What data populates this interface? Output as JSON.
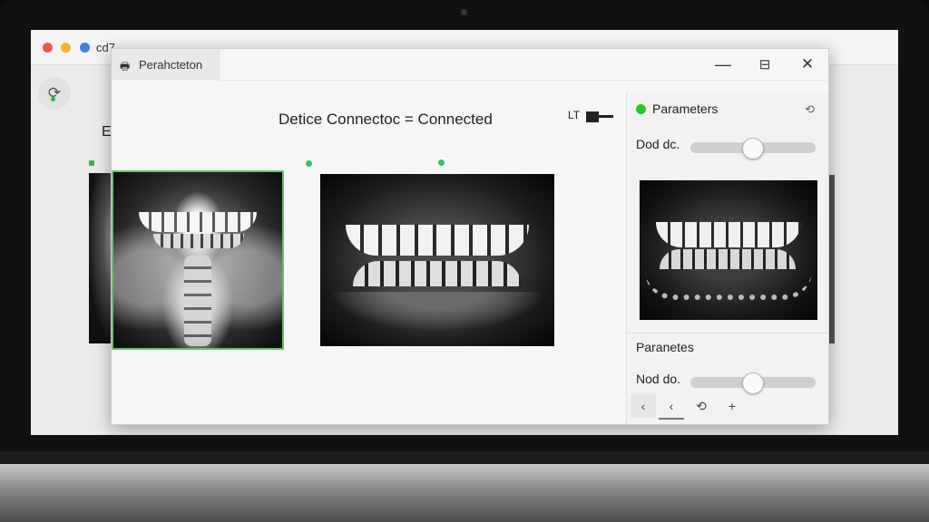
{
  "background_window": {
    "title": "cd7-",
    "partial_letter": "E"
  },
  "window": {
    "tab_label": "Perahcteton",
    "tab_icon": "printer-icon",
    "controls": {
      "minimize": "—",
      "maximize": "⊟",
      "close": "✕"
    }
  },
  "status": {
    "text": "Detice Connectoc = Connected",
    "usb_label": "LT"
  },
  "panel": {
    "title": "Parameters",
    "slider1": {
      "label": "Dod dc.",
      "value": 0.5
    },
    "subtitle": "Paranetes",
    "slider2": {
      "label": "Nod do.",
      "value": 0.5
    },
    "status_color": "#22cc22"
  },
  "toolbar": {
    "back1": "‹",
    "back2": "‹",
    "rotate": "⟲",
    "add": "+"
  }
}
